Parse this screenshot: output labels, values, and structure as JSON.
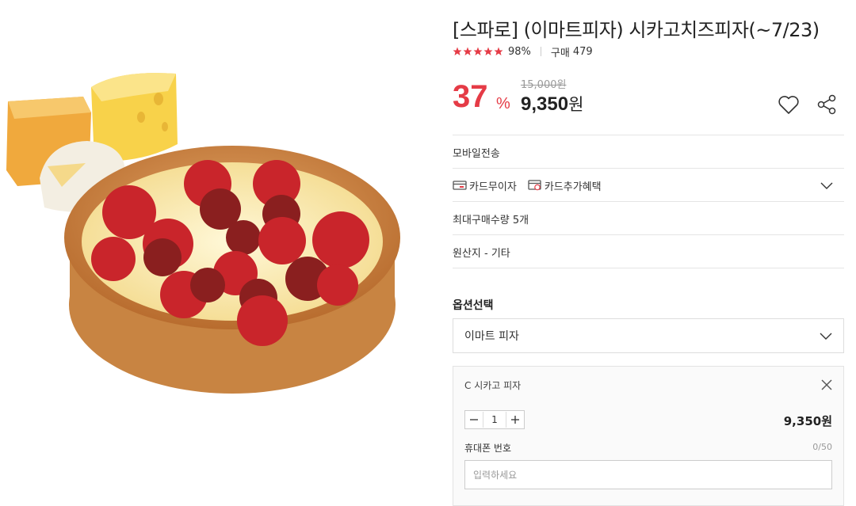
{
  "product": {
    "title": "[스파로] (이마트피자) 시카고치즈피자(~7/23)",
    "rating_percent": "98%",
    "purchase_label": "구매",
    "purchase_count": "479",
    "stars": 5
  },
  "price": {
    "discount_rate": "37",
    "discount_unit": "%",
    "original": "15,000원",
    "sale": "9,350",
    "sale_unit": "원"
  },
  "info_rows": {
    "mobile_delivery": "모바일전송",
    "card_installment": "카드무이자",
    "card_benefit": "카드추가혜택",
    "max_purchase": "최대구매수량 5개",
    "origin": "원산지 - 기타"
  },
  "option": {
    "label": "옵션선택",
    "selected": "이마트 피자"
  },
  "selected_item": {
    "name": "C 시카고 피자",
    "quantity": "1",
    "price": "9,350원",
    "phone_label": "휴대폰 번호",
    "phone_count": "0/50",
    "phone_placeholder": "입력하세요"
  },
  "colors": {
    "accent": "#e53b46",
    "star": "#e53b46",
    "border": "#e5e5e5"
  },
  "icons": {
    "like": "heart-icon",
    "share": "share-icon",
    "expand": "chevron-down-icon",
    "remove": "close-icon",
    "minus": "minus-icon",
    "plus": "plus-icon"
  }
}
